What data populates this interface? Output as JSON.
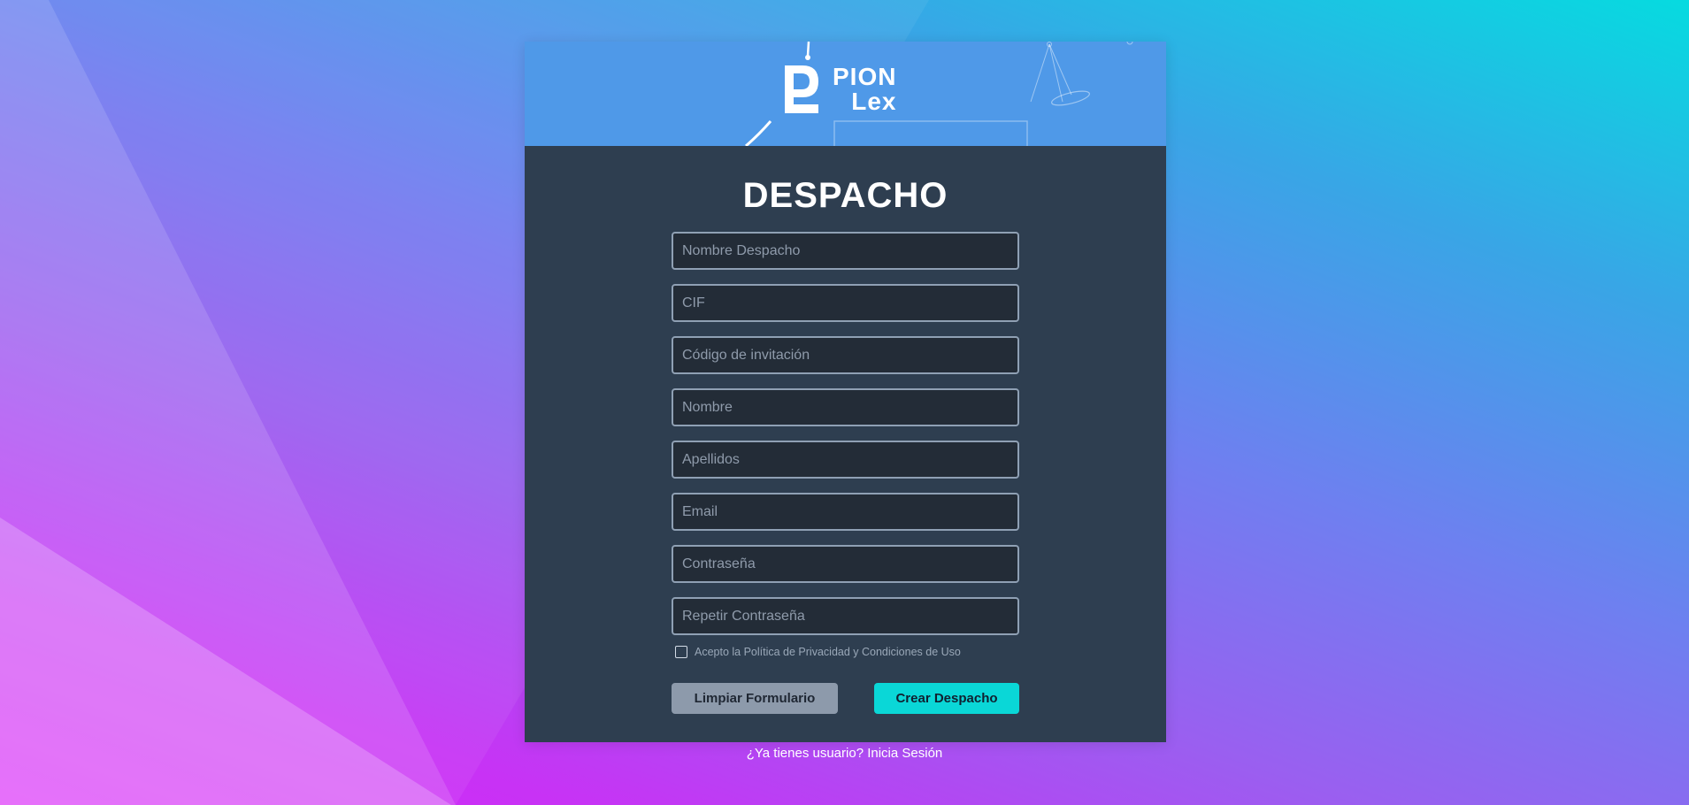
{
  "brand": {
    "line1": "PION",
    "line2": "Lex"
  },
  "form": {
    "title": "DESPACHO",
    "fields": [
      {
        "placeholder": "Nombre Despacho"
      },
      {
        "placeholder": "CIF"
      },
      {
        "placeholder": "Código de invitación"
      },
      {
        "placeholder": "Nombre"
      },
      {
        "placeholder": "Apellidos"
      },
      {
        "placeholder": "Email"
      },
      {
        "placeholder": "Contraseña"
      },
      {
        "placeholder": "Repetir Contraseña"
      }
    ],
    "terms_label": "Acepto la Política de Privacidad y Condiciones de Uso",
    "terms_checked": false,
    "clear_button": "Limpiar Formulario",
    "submit_button": "Crear Despacho"
  },
  "login_link": "¿Ya tienes usuario? Inicia Sesión",
  "colors": {
    "header": "#4f99e8",
    "card": "#2e3e50",
    "field_bg": "#232c37",
    "field_border": "#8fa0b4",
    "accent": "#0ad7d7",
    "secondary_button": "#8d9aab"
  },
  "icons": {
    "logo": "pionlex-logo-icon",
    "checkbox": "checkbox-icon"
  }
}
